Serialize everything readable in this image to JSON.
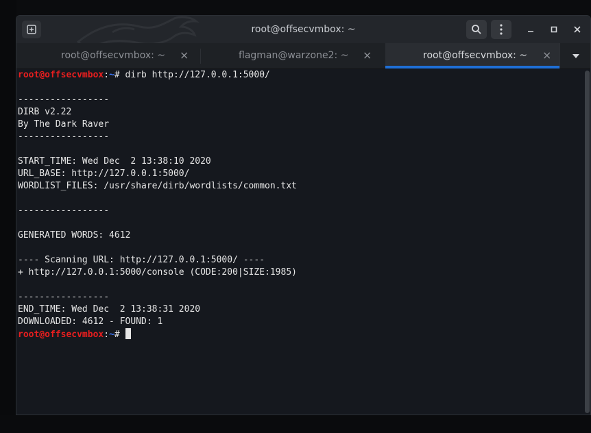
{
  "window": {
    "title": "root@offsecvmbox: ~",
    "new_tab_icon": "terminal-plus-icon",
    "search_icon": "search-icon",
    "menu_icon": "kebab-menu-icon",
    "minimize_label": "–",
    "maximize_label": "▫",
    "close_label": "✕"
  },
  "tabs": [
    {
      "label": "root@offsecvmbox: ~",
      "close": "×",
      "active": false
    },
    {
      "label": "flagman@warzone2: ~",
      "close": "×",
      "active": false
    },
    {
      "label": "root@offsecvmbox: ~",
      "close": "×",
      "active": true
    }
  ],
  "tab_menu_icon": "chevron-down-icon",
  "prompt": {
    "user_host": "root@offsecvmbox",
    "sep": ":",
    "path": "~",
    "symbol": "# "
  },
  "terminal": {
    "command": "dirb http://127.0.0.1:5000/",
    "lines": [
      "",
      "-----------------",
      "DIRB v2.22",
      "By The Dark Raver",
      "-----------------",
      "",
      "START_TIME: Wed Dec  2 13:38:10 2020",
      "URL_BASE: http://127.0.0.1:5000/",
      "WORDLIST_FILES: /usr/share/dirb/wordlists/common.txt",
      "",
      "-----------------",
      "",
      "GENERATED WORDS: 4612",
      "",
      "---- Scanning URL: http://127.0.0.1:5000/ ----",
      "+ http://127.0.0.1:5000/console (CODE:200|SIZE:1985)",
      "",
      "-----------------",
      "END_TIME: Wed Dec  2 13:38:31 2020",
      "DOWNLOADED: 4612 - FOUND: 1"
    ]
  },
  "colors": {
    "prompt_user": "#e81e1e",
    "prompt_path": "#3b78ff",
    "active_tab_accent": "#1f6fd6",
    "terminal_bg": "#15181e"
  }
}
